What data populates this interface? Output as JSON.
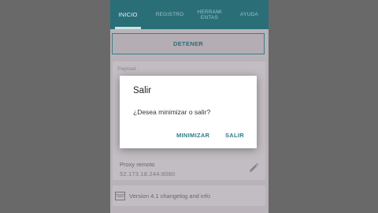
{
  "tabs": [
    {
      "label": "INICIO"
    },
    {
      "label": "REGISTRO"
    },
    {
      "label": "HERRAMIENTAS",
      "line1": "HERRAMI",
      "line2": "ENTAS"
    },
    {
      "label": "AYUDA"
    }
  ],
  "main": {
    "stop_label": "DETENER",
    "payload_label": "Payload :",
    "proxy_label": "Proxy remoto",
    "proxy_value": "52.173.18.244:8080",
    "changelog_label": "Version 4.1 changelog and info"
  },
  "dialog": {
    "title": "Salir",
    "message": "¿Desea minimizar o salir?",
    "minimize_label": "MINIMIZAR",
    "exit_label": "SALIR"
  },
  "icons": {
    "edit": "pencil-icon",
    "changelog": "list-icon"
  },
  "colors": {
    "appbar": "#2a6f78",
    "accent": "#2e7d86",
    "background": "#696969"
  }
}
